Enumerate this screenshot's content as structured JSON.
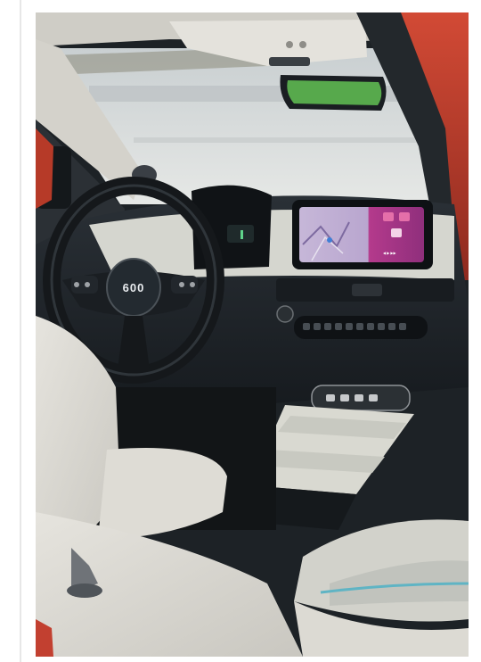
{
  "photo": {
    "subject": "car-interior",
    "colors": {
      "body_red": "#c8432f",
      "seat_cream": "#dcdad3",
      "dash_dark": "#1e2328",
      "screen_pink": "#b8368a",
      "screen_map": "#c9b9d6",
      "console_cream": "#d8d8d0",
      "window_sky": "#d7dad8"
    }
  },
  "steering_wheel": {
    "logo": "600"
  },
  "infotainment": {
    "status_time": "",
    "apps_label": ""
  }
}
